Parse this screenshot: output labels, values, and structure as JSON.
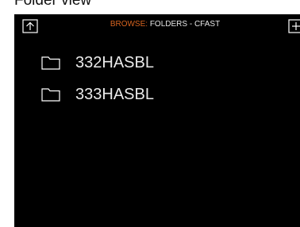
{
  "window": {
    "title": "Folder view"
  },
  "header": {
    "prefix": "BROWSE:",
    "path": "FOLDERS - CFAST",
    "up_icon": "arrow-up-icon",
    "add_icon": "add-icon"
  },
  "folders": [
    {
      "name": "332HASBL",
      "icon": "folder-icon"
    },
    {
      "name": "333HASBL",
      "icon": "folder-icon"
    }
  ],
  "colors": {
    "background": "#000000",
    "accent": "#d8641f",
    "text": "#eaeaea"
  }
}
